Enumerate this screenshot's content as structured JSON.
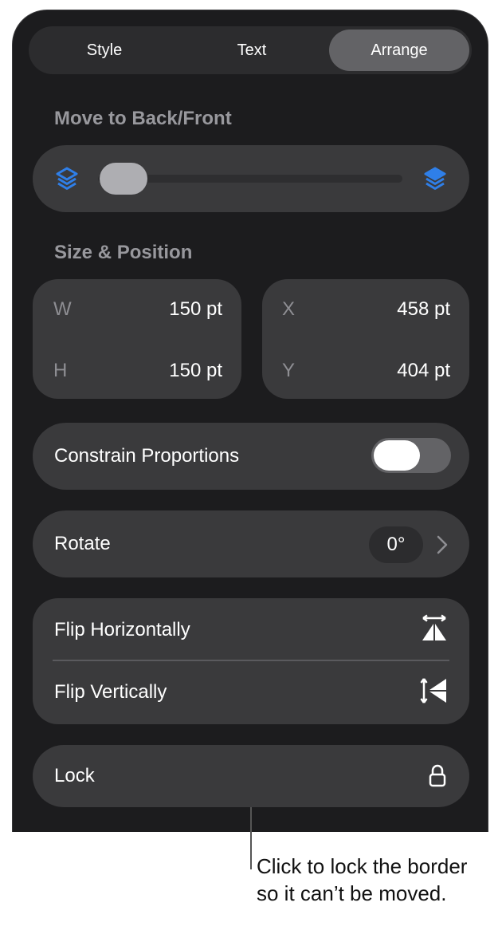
{
  "tabs": {
    "style": "Style",
    "text": "Text",
    "arrange": "Arrange",
    "active": "Arrange"
  },
  "move": {
    "label": "Move to Back/Front",
    "slider_fraction": 0.0
  },
  "size_position": {
    "label": "Size & Position",
    "w_label": "W",
    "w_value": "150 pt",
    "h_label": "H",
    "h_value": "150 pt",
    "x_label": "X",
    "x_value": "458 pt",
    "y_label": "Y",
    "y_value": "404 pt"
  },
  "constrain": {
    "label": "Constrain Proportions",
    "on": false
  },
  "rotate": {
    "label": "Rotate",
    "value": "0°"
  },
  "flip": {
    "horizontal": "Flip Horizontally",
    "vertical": "Flip Vertically"
  },
  "lock": {
    "label": "Lock"
  },
  "callout": {
    "line1": "Click to lock the border",
    "line2": "so it can’t be moved."
  },
  "colors": {
    "accent_blue": "#2f7fe8",
    "panel_bg": "#1c1c1e",
    "card_bg": "#3a3a3c"
  }
}
